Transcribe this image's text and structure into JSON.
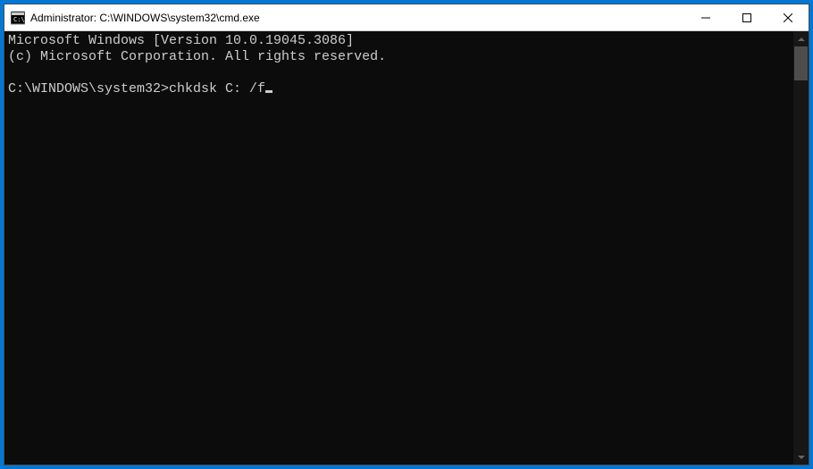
{
  "window": {
    "title": "Administrator: C:\\WINDOWS\\system32\\cmd.exe"
  },
  "terminal": {
    "line1": "Microsoft Windows [Version 10.0.19045.3086]",
    "line2": "(c) Microsoft Corporation. All rights reserved.",
    "blank": "",
    "prompt": "C:\\WINDOWS\\system32>",
    "command": "chkdsk C: /f"
  }
}
